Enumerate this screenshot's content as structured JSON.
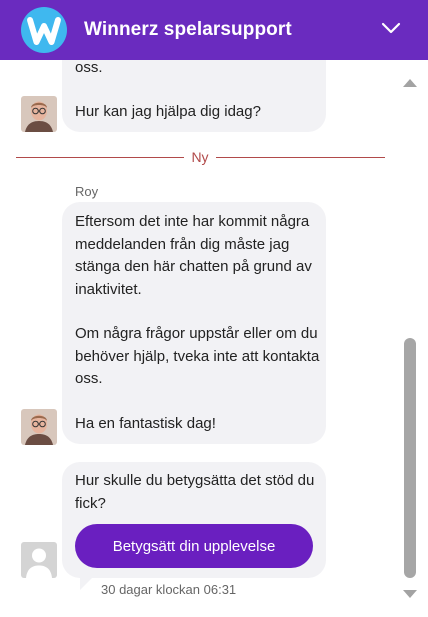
{
  "header": {
    "title": "Winnerz spelarsupport",
    "logo_letter": "W",
    "brand_color": "#6a2bbf",
    "logo_color": "#3fb8ef",
    "collapse_icon": "chevron-down-icon"
  },
  "messages": {
    "first_partial": "oss.",
    "first_question": "Hur kan jag hjälpa dig idag?",
    "divider_label": "Ny",
    "sender_name": "Roy",
    "inactivity_p1": "Eftersom det inte har kommit några meddelanden från dig måste jag stänga den här chatten på grund av inaktivitet.",
    "inactivity_p2": "Om några frågor uppstår eller om du behöver hjälp, tveka inte att kontakta oss.",
    "inactivity_p3": "Ha en fantastisk dag!",
    "rating_question": "Hur skulle du betygsätta det stöd du fick?",
    "rating_button": "Betygsätt din upplevelse",
    "timestamp": "30 dagar klockan 06:31"
  },
  "colors": {
    "bubble": "#f2f2f5",
    "divider": "#b14a4a",
    "button": "#6a1fc0"
  }
}
